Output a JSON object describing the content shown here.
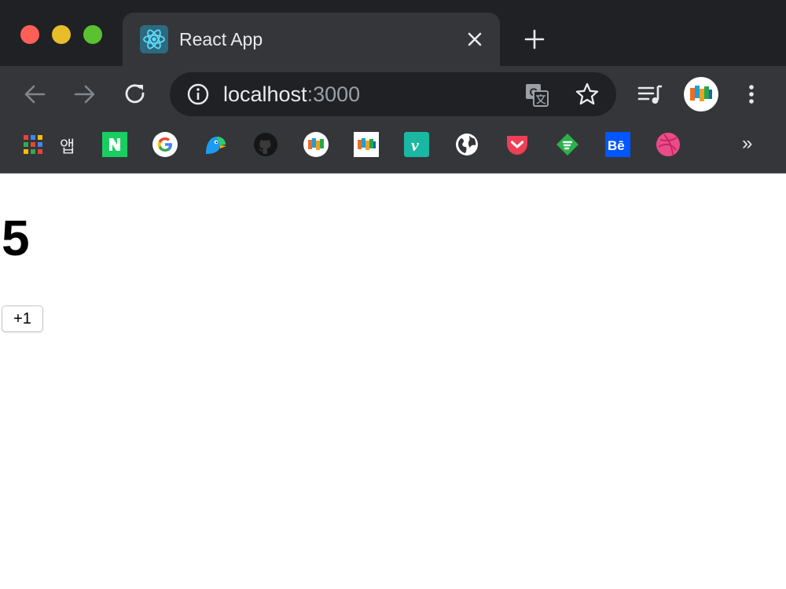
{
  "window": {
    "traffic_lights": {
      "close_color": "#fe5f57",
      "minimize_color": "#e8bd2c",
      "maximize_color": "#5ac230"
    }
  },
  "tab": {
    "title": "React App",
    "favicon": "react-icon",
    "close_icon": "close-icon"
  },
  "toolbar": {
    "back_icon": "arrow-left-icon",
    "forward_icon": "arrow-right-icon",
    "reload_icon": "reload-icon",
    "address": {
      "host": "localhost",
      "port": ":3000"
    },
    "info_icon": "info-icon",
    "translate_icon": "translate-icon",
    "bookmark_star_icon": "star-icon",
    "media_icon": "media-playlist-icon",
    "menu_icon": "kebab-menu-icon"
  },
  "bookmarks": {
    "apps_label": "앱",
    "items": [
      "naver-icon",
      "google-icon",
      "bird-icon",
      "github-icon",
      "profile-icon",
      "profile-icon-2",
      "vimeo-icon",
      "globe-icon",
      "pocket-icon",
      "feedly-icon",
      "behance-icon",
      "dribbble-icon"
    ],
    "more_label": "»"
  },
  "content": {
    "count": "5",
    "button_label": "+1"
  }
}
